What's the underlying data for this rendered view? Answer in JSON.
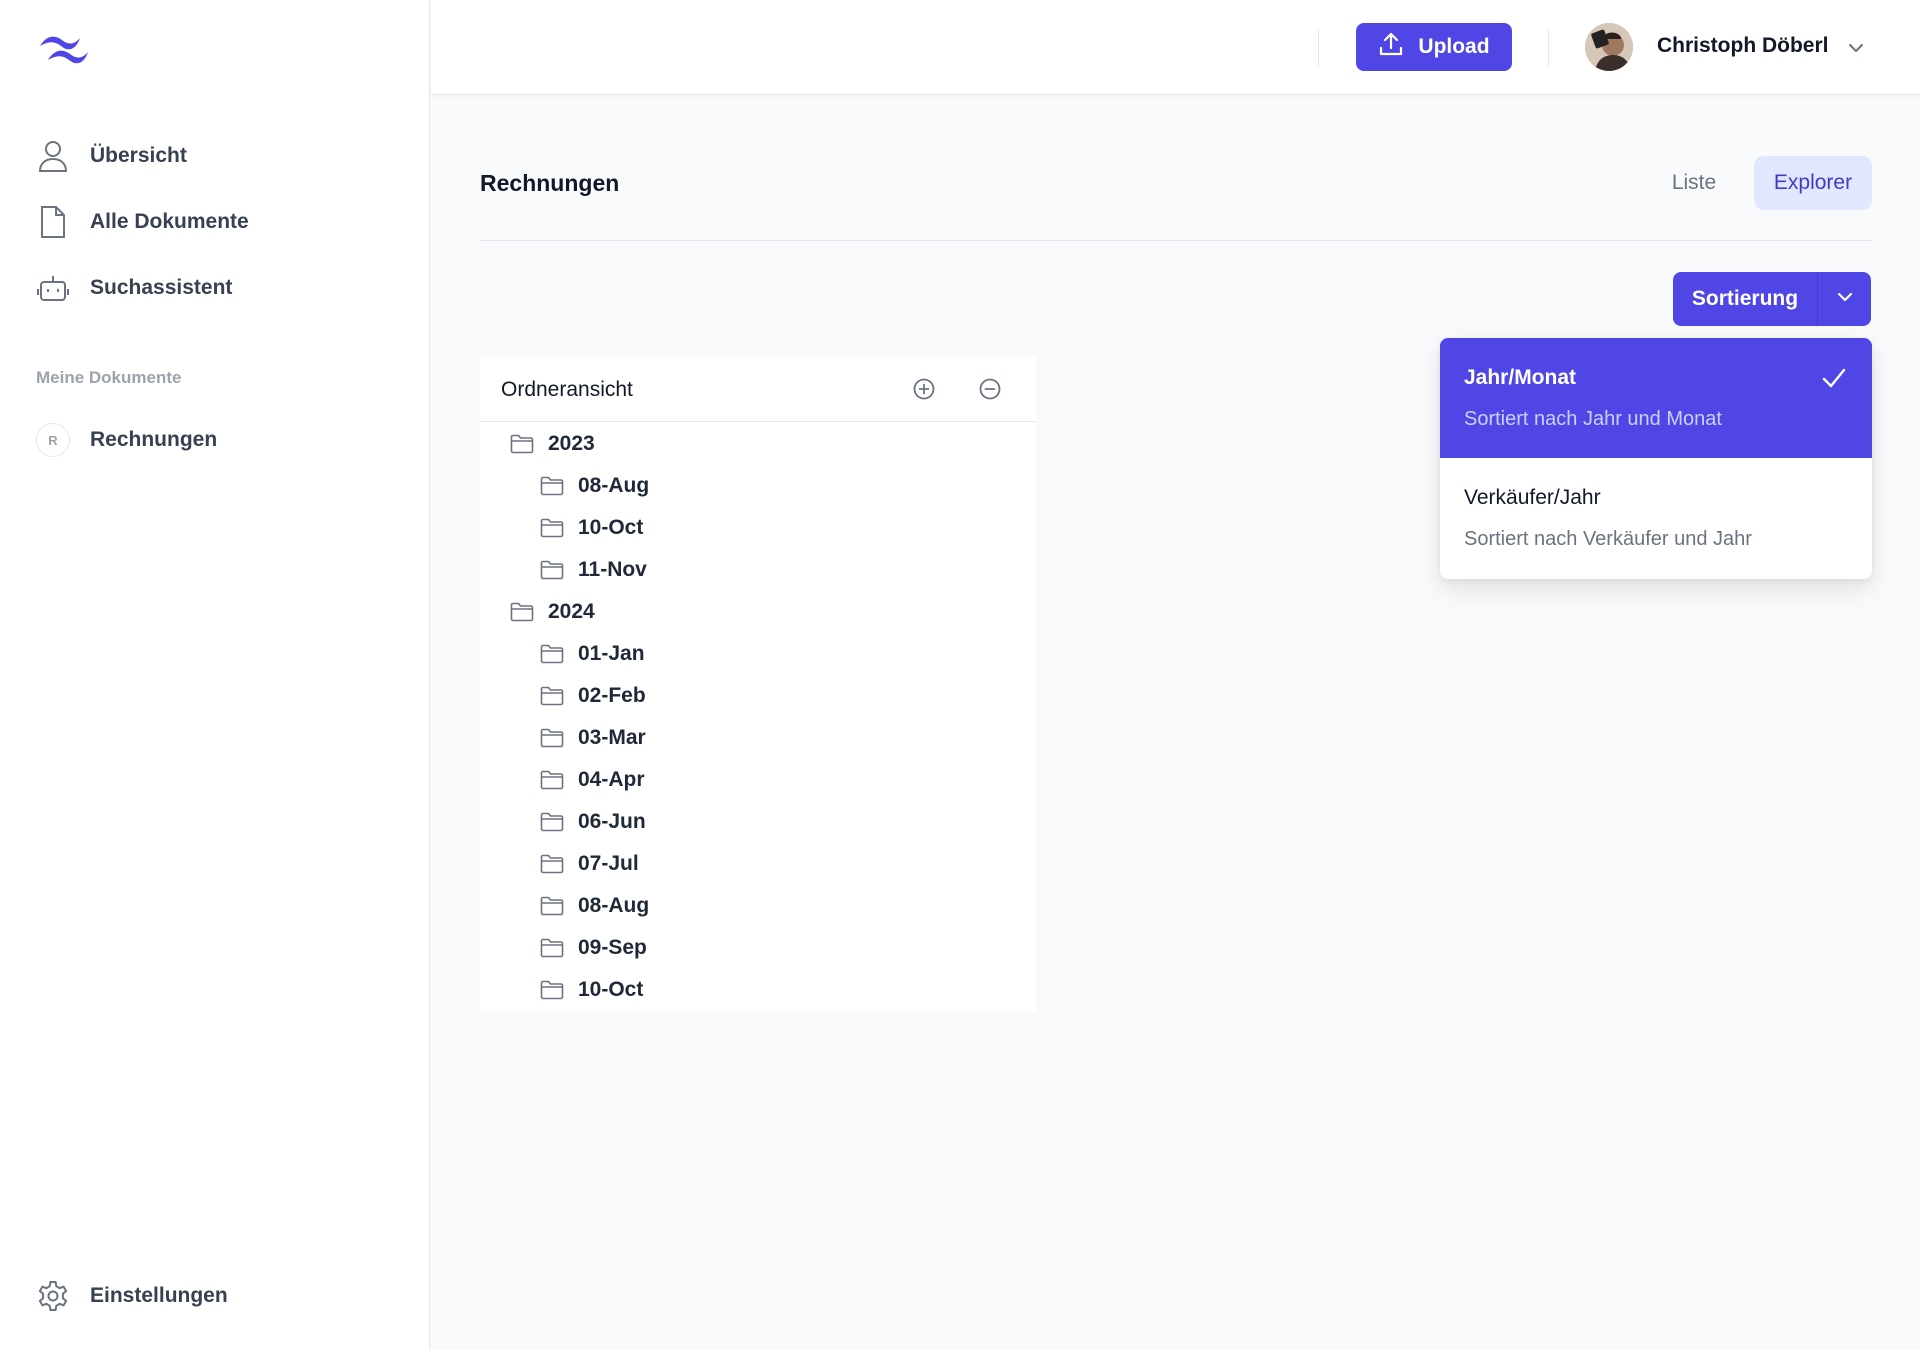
{
  "sidebar": {
    "nav": [
      {
        "label": "Übersicht"
      },
      {
        "label": "Alle Dokumente"
      },
      {
        "label": "Suchassistent"
      }
    ],
    "section_label": "Meine Dokumente",
    "documents": [
      {
        "badge": "R",
        "label": "Rechnungen"
      }
    ],
    "settings_label": "Einstellungen"
  },
  "header": {
    "upload_label": "Upload",
    "user_name": "Christoph Döberl"
  },
  "main": {
    "title": "Rechnungen",
    "tabs": [
      {
        "label": "Liste",
        "active": false
      },
      {
        "label": "Explorer",
        "active": true
      }
    ],
    "sort_label": "Sortierung",
    "sort_options": [
      {
        "title": "Jahr/Monat",
        "description": "Sortiert nach Jahr und Monat",
        "selected": true
      },
      {
        "title": "Verkäufer/Jahr",
        "description": "Sortiert nach Verkäufer und Jahr",
        "selected": false
      }
    ],
    "tree": {
      "title": "Ordneransicht",
      "items": [
        {
          "label": "2023",
          "level": 0
        },
        {
          "label": "08-Aug",
          "level": 1
        },
        {
          "label": "10-Oct",
          "level": 1
        },
        {
          "label": "11-Nov",
          "level": 1
        },
        {
          "label": "2024",
          "level": 0
        },
        {
          "label": "01-Jan",
          "level": 1
        },
        {
          "label": "02-Feb",
          "level": 1
        },
        {
          "label": "03-Mar",
          "level": 1
        },
        {
          "label": "04-Apr",
          "level": 1
        },
        {
          "label": "06-Jun",
          "level": 1
        },
        {
          "label": "07-Jul",
          "level": 1
        },
        {
          "label": "08-Aug",
          "level": 1
        },
        {
          "label": "09-Sep",
          "level": 1
        },
        {
          "label": "10-Oct",
          "level": 1
        }
      ]
    }
  },
  "colors": {
    "accent": "#4f46e5",
    "accent_light": "#e0e7ff",
    "text_muted": "#6b7280"
  }
}
